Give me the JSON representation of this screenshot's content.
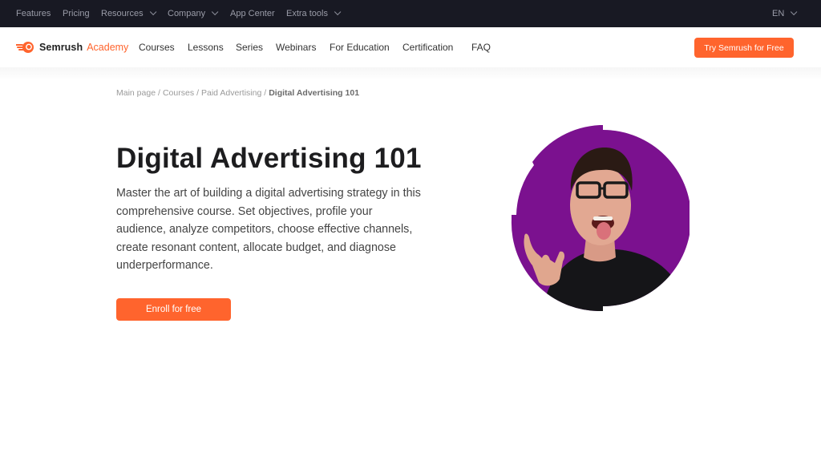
{
  "topbar": {
    "items": [
      {
        "label": "Features",
        "has_dropdown": false
      },
      {
        "label": "Pricing",
        "has_dropdown": false
      },
      {
        "label": "Resources",
        "has_dropdown": true
      },
      {
        "label": "Company",
        "has_dropdown": true
      },
      {
        "label": "App Center",
        "has_dropdown": false
      },
      {
        "label": "Extra tools",
        "has_dropdown": true
      }
    ],
    "language": "EN"
  },
  "mainnav": {
    "logo": {
      "brand": "Semrush",
      "product": "Academy",
      "icon": "semrush-fireball-icon"
    },
    "items": [
      {
        "label": "Courses"
      },
      {
        "label": "Lessons"
      },
      {
        "label": "Series"
      },
      {
        "label": "Webinars"
      },
      {
        "label": "For Education"
      },
      {
        "label": "Certification"
      },
      {
        "label": "FAQ"
      }
    ],
    "cta_label": "Try Semrush for Free"
  },
  "breadcrumb": {
    "items": [
      "Main page",
      "Courses",
      "Paid Advertising"
    ],
    "current": "Digital Advertising 101",
    "separator": "/"
  },
  "hero": {
    "title": "Digital Advertising 101",
    "description": "Master the art of building a digital advertising strategy in this comprehensive course. Set objectives, profile your audience, analyze competitors, choose effective channels, create resonant content, allocate budget, and diagnose underperformance.",
    "enroll_label": "Enroll for free",
    "image": "instructor-portrait"
  },
  "colors": {
    "accent": "#ff642d",
    "topbar_bg": "#181923",
    "portrait_bg": "#7b118f",
    "title_text": "#1d1d1f"
  }
}
